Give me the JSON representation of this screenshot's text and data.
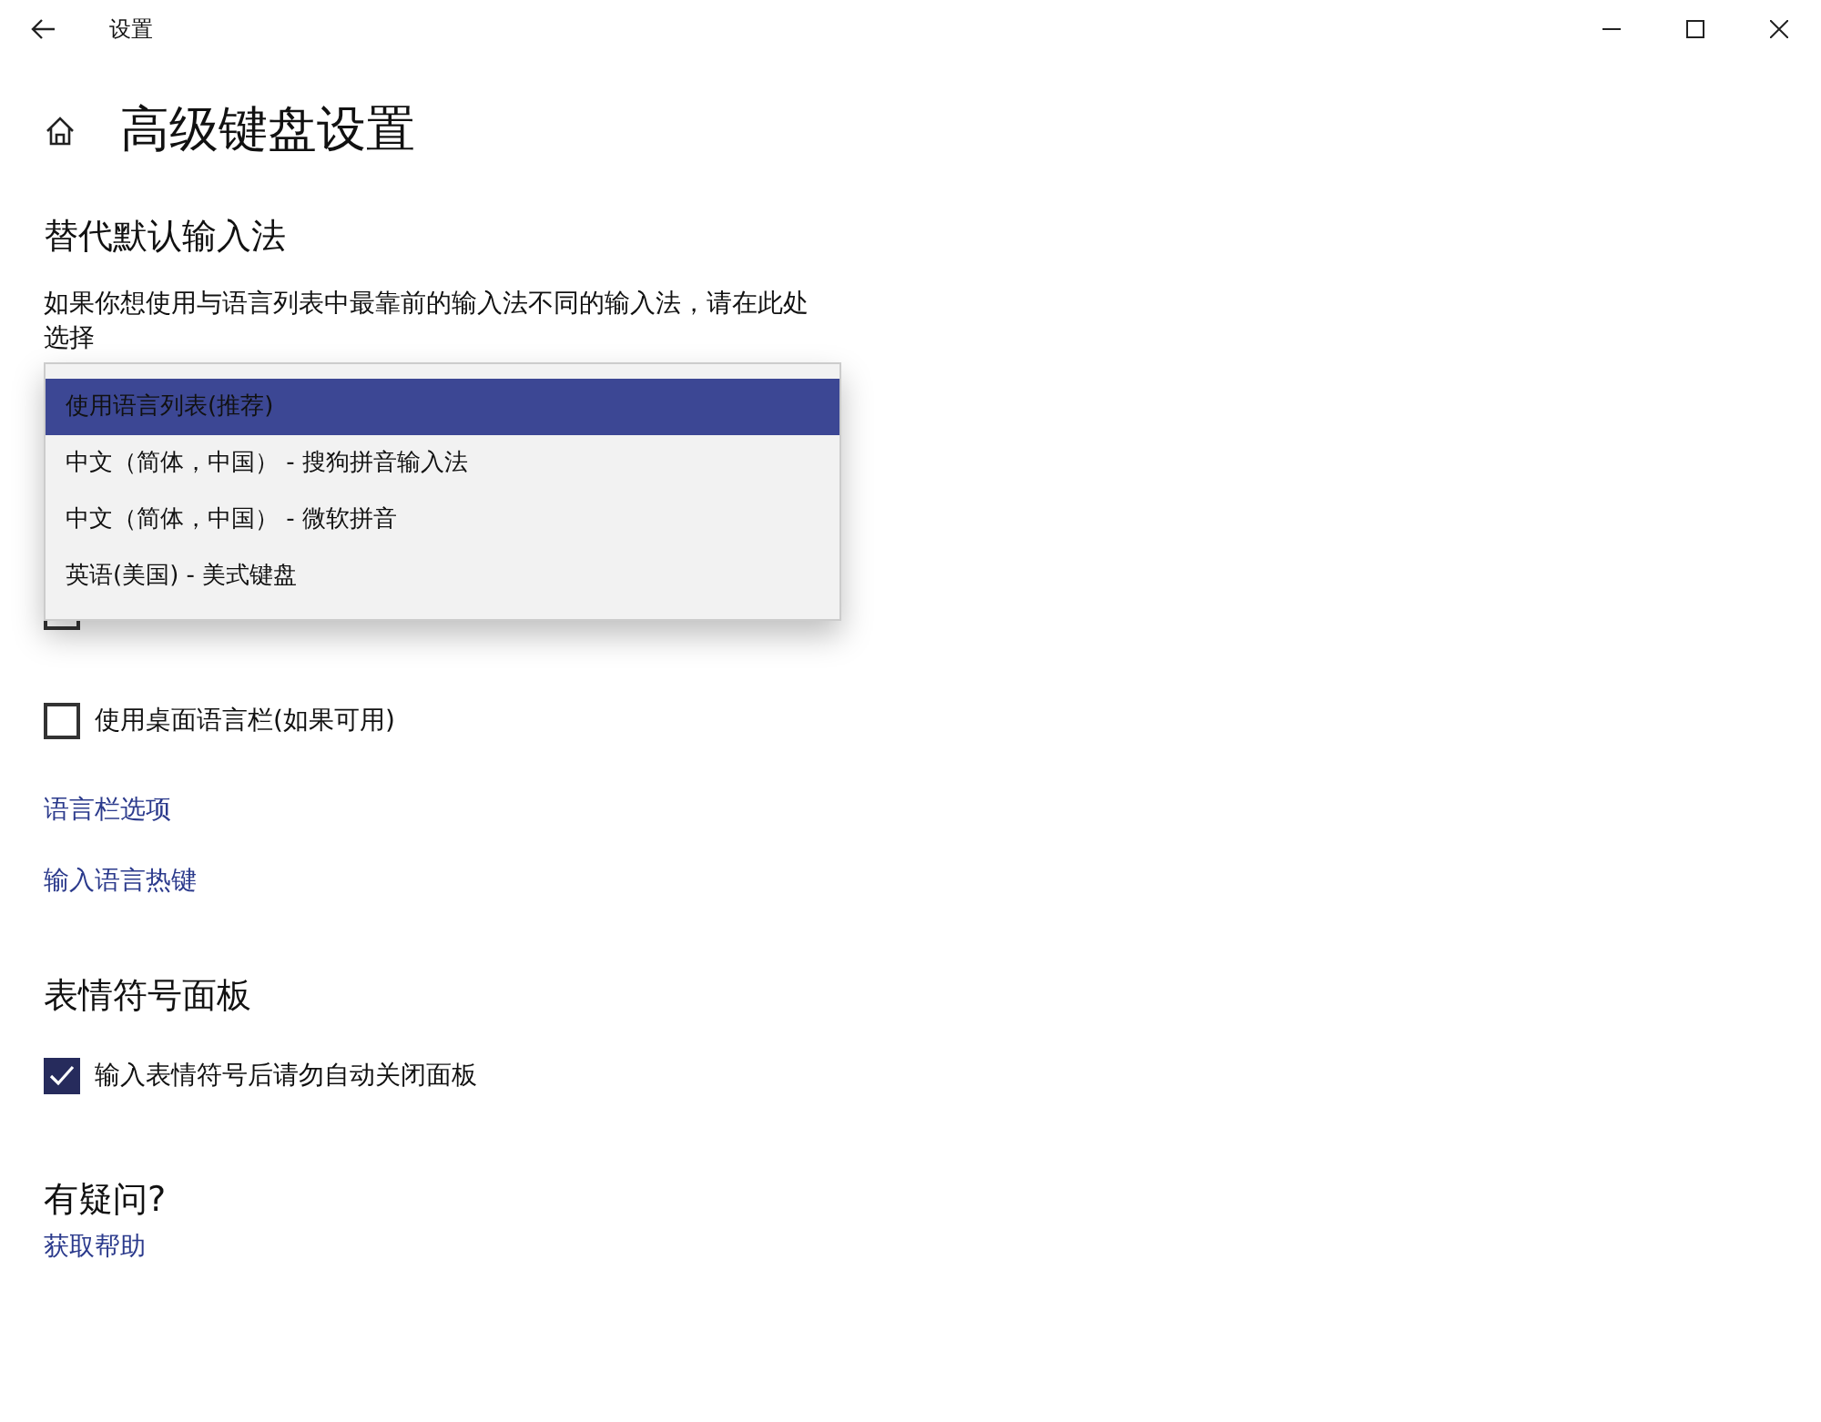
{
  "window": {
    "title": "设置"
  },
  "page_title": "高级键盘设置",
  "sections": [
    {
      "heading": "替代默认输入法",
      "description": "如果你想使用与语言列表中最靠前的输入法不同的输入法，请在此处选择",
      "dropdown": {
        "expanded": true,
        "options": [
          {
            "label": "使用语言列表(推荐)",
            "selected": true
          },
          {
            "label": "中文（简体，中国） - 搜狗拼音输入法",
            "selected": false
          },
          {
            "label": "中文（简体，中国） - 微软拼音",
            "selected": false
          },
          {
            "label": "英语(美国) - 美式键盘",
            "selected": false
          }
        ]
      },
      "items": [
        {
          "kind": "checkbox",
          "checked": false
        },
        {
          "kind": "checkbox",
          "label": "使用桌面语言栏(如果可用)",
          "checked": false
        },
        {
          "kind": "link",
          "label": "语言栏选项"
        },
        {
          "kind": "link",
          "label": "输入语言热键"
        }
      ]
    },
    {
      "heading": "表情符号面板",
      "items": [
        {
          "kind": "checkbox",
          "label": "输入表情符号后请勿自动关闭面板",
          "checked": true
        }
      ]
    },
    {
      "heading": "有疑问?",
      "items": [
        {
          "kind": "link",
          "label": "获取帮助"
        }
      ]
    }
  ]
}
